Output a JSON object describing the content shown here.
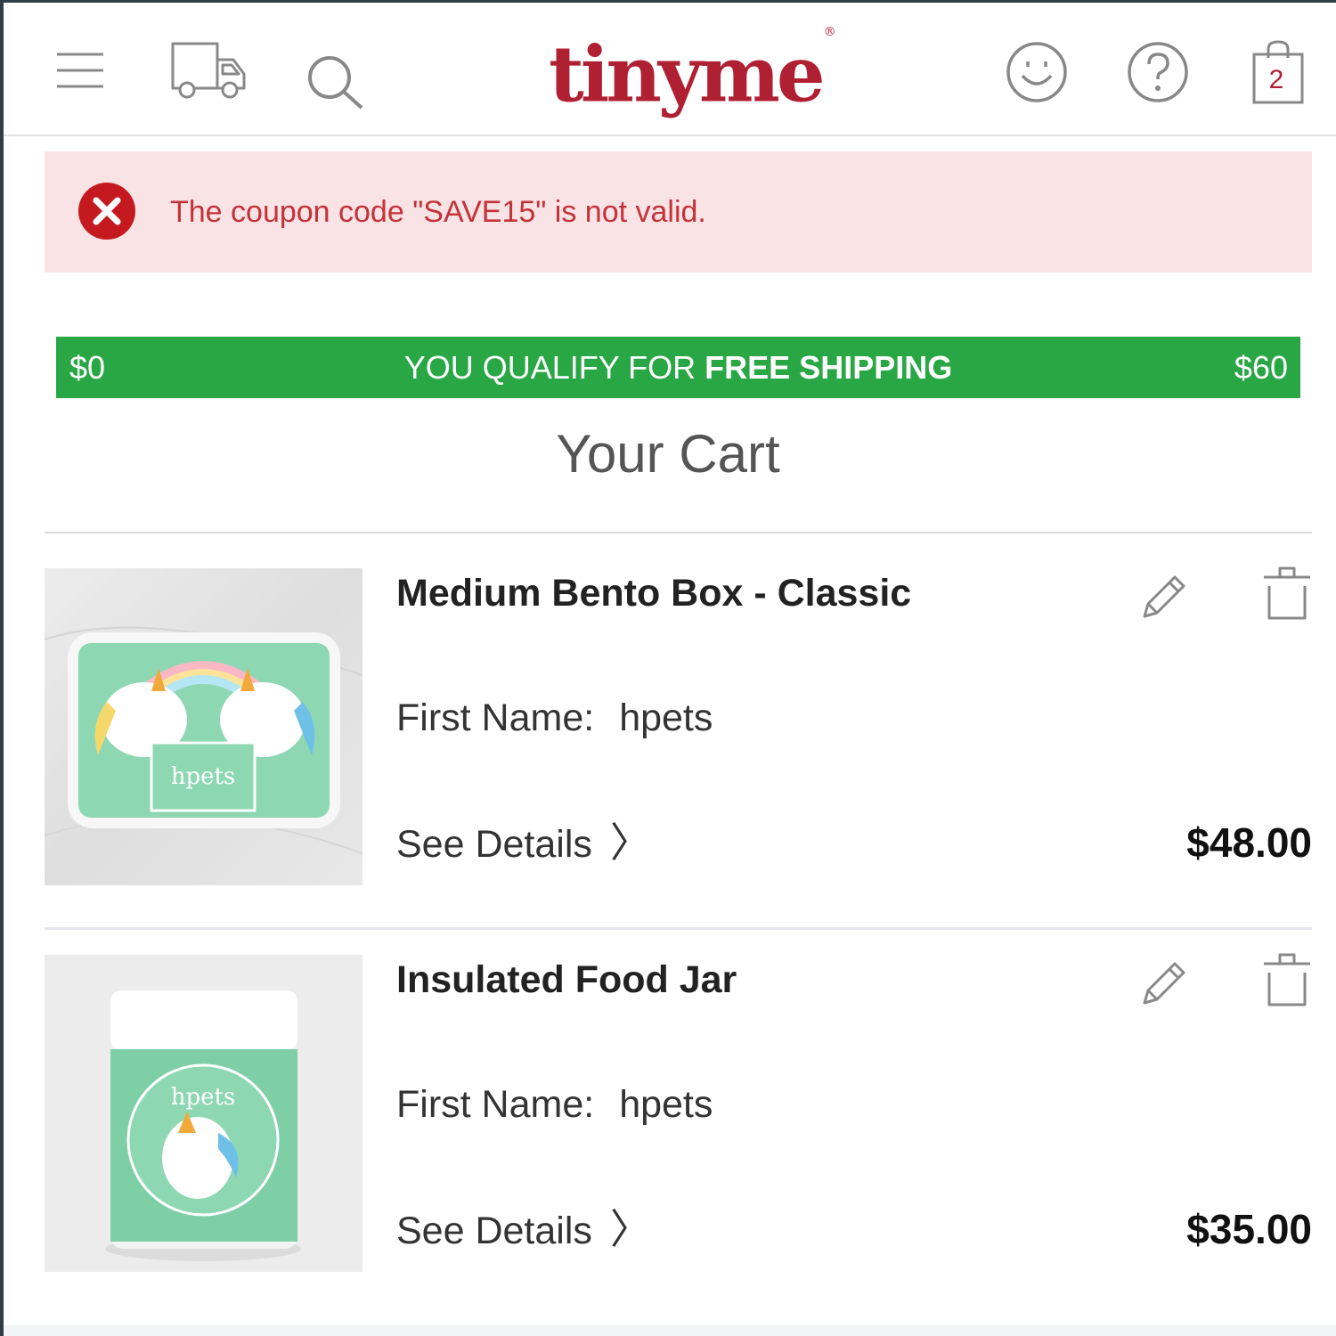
{
  "header": {
    "logo": "tinyme",
    "logo_mark": "®",
    "cart_count": "2",
    "icons": [
      "menu-icon",
      "delivery-truck-icon",
      "search-icon",
      "account-smiley-icon",
      "help-icon",
      "shopping-bag-icon"
    ]
  },
  "alert": {
    "message": "The coupon code \"SAVE15\" is not valid.",
    "icon": "error-x-icon",
    "color": "#c4323a",
    "background": "#f9e3e4"
  },
  "shipping": {
    "min": "$0",
    "max": "$60",
    "message_prefix": "YOU QUALIFY FOR",
    "message_bold": "FREE SHIPPING",
    "progress": 1.0,
    "color": "#2aa745"
  },
  "cart": {
    "title": "Your Cart",
    "items": [
      {
        "name": "Medium Bento Box - Classic",
        "field_label": "First Name:",
        "field_value": "hpets",
        "details_label": "See Details",
        "price": "$48.00",
        "image_text": "hpets"
      },
      {
        "name": "Insulated Food Jar",
        "field_label": "First Name:",
        "field_value": "hpets",
        "details_label": "See Details",
        "price": "$35.00",
        "image_text": "hpets"
      }
    ]
  },
  "colors": {
    "brand": "#b02033",
    "success": "#2aa745"
  }
}
